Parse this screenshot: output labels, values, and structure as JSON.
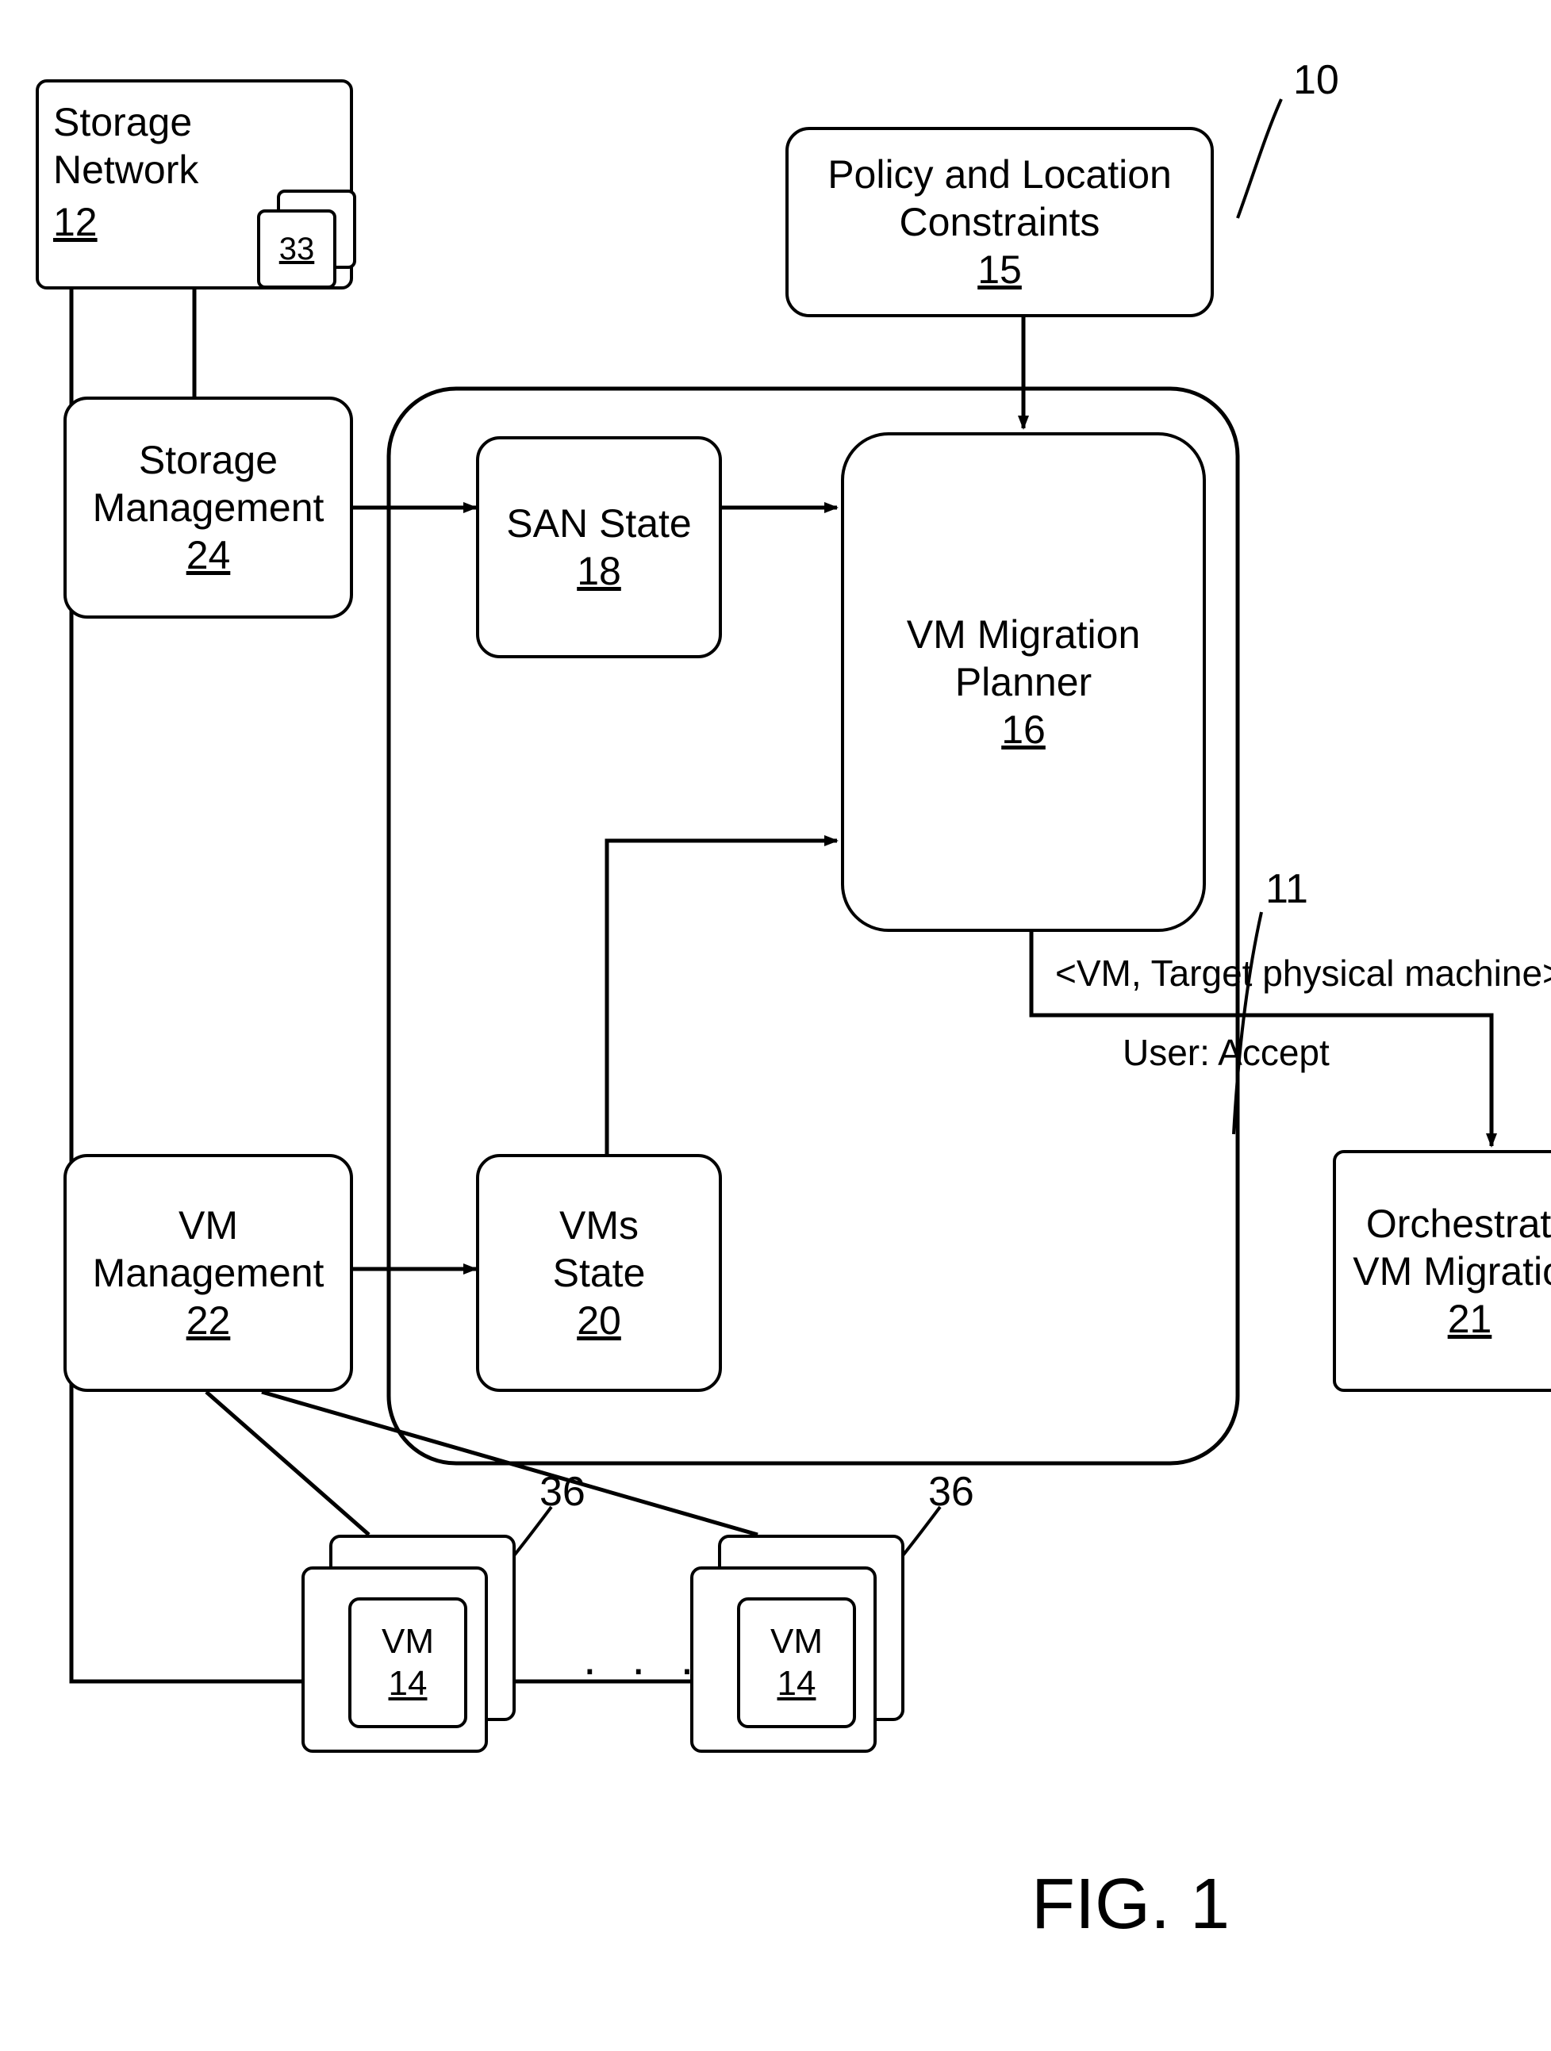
{
  "figure": {
    "caption": "FIG. 1",
    "ref_system": "10",
    "ref_container": "11"
  },
  "boxes": {
    "storage_network": {
      "label": "Storage Network",
      "ref": "12",
      "mini_ref": "33"
    },
    "storage_management": {
      "label": "Storage\nManagement",
      "ref": "24"
    },
    "vm_management": {
      "label": "VM\nManagement",
      "ref": "22"
    },
    "policy": {
      "label": "Policy and Location\nConstraints",
      "ref": "15"
    },
    "san_state": {
      "label": "SAN State",
      "ref": "18"
    },
    "vms_state": {
      "label": "VMs\nState",
      "ref": "20"
    },
    "planner": {
      "label": "VM Migration\nPlanner",
      "ref": "16"
    },
    "orchestrate": {
      "label": "Orchestrate\nVM Migration",
      "ref": "21"
    }
  },
  "vm_stack": {
    "label": "VM",
    "ref_inner": "14",
    "ref_outer": "36",
    "ellipsis": ". . ."
  },
  "arrow_text": {
    "top": "<VM, Target physical machine>",
    "bottom": "User: Accept"
  }
}
